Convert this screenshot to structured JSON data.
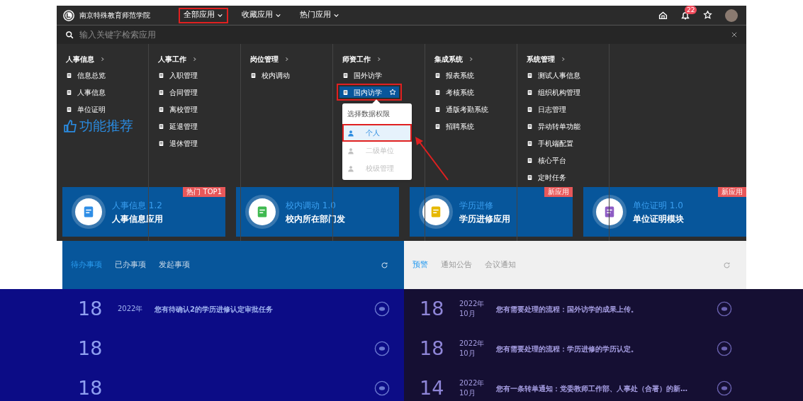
{
  "header": {
    "logo_text": "南京特殊教育师范学院",
    "nav": [
      {
        "label": "全部应用",
        "selected": true
      },
      {
        "label": "收藏应用",
        "selected": false
      },
      {
        "label": "热门应用",
        "selected": false
      }
    ],
    "notification_count": "22"
  },
  "search": {
    "placeholder": "输入关键字检索应用"
  },
  "menu_columns": [
    {
      "title": "人事信息",
      "items": [
        {
          "label": "信息总览",
          "selected": false
        },
        {
          "label": "人事信息",
          "selected": false
        },
        {
          "label": "单位证明",
          "selected": false
        }
      ]
    },
    {
      "title": "人事工作",
      "items": [
        {
          "label": "入职管理",
          "selected": false
        },
        {
          "label": "合同管理",
          "selected": false
        },
        {
          "label": "离校管理",
          "selected": false
        },
        {
          "label": "延退管理",
          "selected": false
        },
        {
          "label": "退休管理",
          "selected": false
        }
      ]
    },
    {
      "title": "岗位管理",
      "items": [
        {
          "label": "校内调动",
          "selected": false
        }
      ]
    },
    {
      "title": "师资工作",
      "items": [
        {
          "label": "国外访学",
          "selected": false
        },
        {
          "label": "国内访学",
          "selected": true
        }
      ]
    },
    {
      "title": "集成系统",
      "items": [
        {
          "label": "报表系统",
          "selected": false
        },
        {
          "label": "考核系统",
          "selected": false
        },
        {
          "label": "通版考勤系统",
          "selected": false
        },
        {
          "label": "招聘系统",
          "selected": false
        }
      ]
    },
    {
      "title": "系统管理",
      "items": [
        {
          "label": "测试人事信息",
          "selected": false
        },
        {
          "label": "组织机构管理",
          "selected": false
        },
        {
          "label": "日志管理",
          "selected": false
        },
        {
          "label": "异动转单功能",
          "selected": false
        },
        {
          "label": "手机端配置",
          "selected": false
        },
        {
          "label": "核心平台",
          "selected": false
        },
        {
          "label": "定时任务",
          "selected": false
        }
      ]
    }
  ],
  "banner": {
    "text": "功能推荐"
  },
  "cards": [
    {
      "title": "人事信息 1.2",
      "subtitle": "人事信息应用",
      "badge": "热门 TOP1",
      "color": "#2f8ee6"
    },
    {
      "title": "校内调动 1.0",
      "subtitle": "校内所在部门发",
      "color": "#3fb950"
    },
    {
      "title": "学历进修",
      "subtitle": "学历进修应用",
      "badge": "新应用",
      "color": "#e6b800"
    },
    {
      "title": "单位证明 1.0",
      "subtitle": "单位证明模块",
      "badge": "新应用",
      "color": "#8e5cc4"
    }
  ],
  "permission_popup": {
    "title": "选择数据权限",
    "options": [
      {
        "label": "个人",
        "selected": true,
        "disabled": false
      },
      {
        "label": "二级单位",
        "selected": false,
        "disabled": true
      },
      {
        "label": "校级管理",
        "selected": false,
        "disabled": true
      }
    ]
  },
  "todo_panel": {
    "tabs": [
      {
        "label": "待办事项",
        "selected": true
      },
      {
        "label": "已办事项",
        "selected": false
      },
      {
        "label": "发起事项",
        "selected": false
      }
    ],
    "rows": [
      {
        "day": "18",
        "year": "2022年",
        "text": "您有待确认2的学历进修认定审批任务"
      },
      {
        "day": "18"
      },
      {
        "day": "18"
      }
    ]
  },
  "notice_panel": {
    "tabs": [
      {
        "label": "预警",
        "selected": true
      },
      {
        "label": "通知公告",
        "selected": false
      },
      {
        "label": "会议通知",
        "selected": false
      }
    ],
    "rows": [
      {
        "day": "18",
        "year": "2022年",
        "month": "10月",
        "text": "您有需要处理的流程：国外访学的成果上传。"
      },
      {
        "day": "18",
        "year": "2022年",
        "month": "10月",
        "text": "您有需要处理的流程：学历进修的学历认定。"
      },
      {
        "day": "14",
        "year": "2022年",
        "month": "10月",
        "text": "您有一条转单通知：党委教师工作部、人事处（合署）的新…"
      }
    ]
  }
}
